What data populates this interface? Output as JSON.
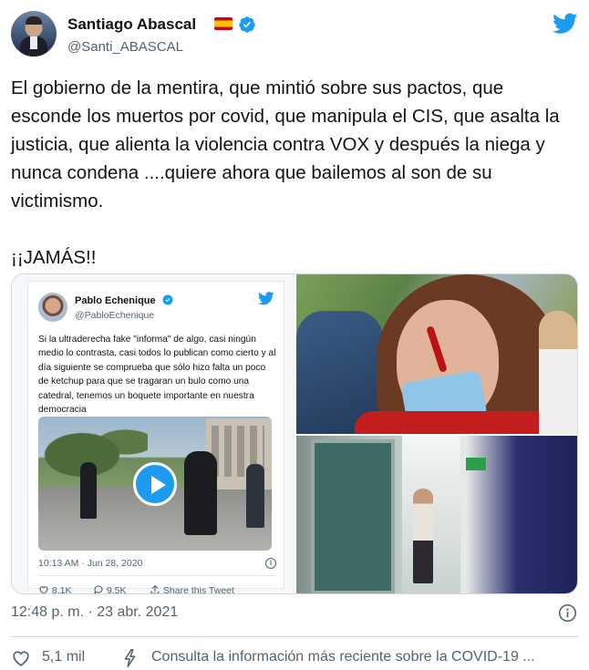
{
  "header": {
    "name": "Santiago Abascal",
    "handle": "@Santi_ABASCAL"
  },
  "tweet": {
    "text": "El gobierno de la mentira, que mintió sobre sus pactos, que esconde los muertos por covid, que manipula el CIS, que asalta la justicia, que alienta la violencia contra VOX y después la niega y nunca condena ....quiere ahora que bailemos al son de su victimismo.\n\n¡¡JAMÁS!!"
  },
  "embedded": {
    "name": "Pablo Echenique",
    "handle": "@PabloEchenique",
    "text": "Si la ultraderecha fake \"informa\" de algo, casi ningún medio lo contrasta, casi todos lo publican como cierto y al día siguiente se comprueba que sólo hizo falta un poco de ketchup para que se tragaran un bulo como una catedral, tenemos un boquete importante en nuestra democracia",
    "time": "10:13 AM · Jun 28, 2020",
    "info": "i",
    "likes": "8.1K",
    "retweets": "9.5K",
    "share": "Share this Tweet"
  },
  "meta": {
    "timestamp": "12:48 p. m. · 23 abr. 2021"
  },
  "footer": {
    "likes": "5,1 mil",
    "covid_notice": "Consulta la información más reciente sobre la COVID-19 ..."
  },
  "colors": {
    "accent": "#1d9bf0",
    "secondary_text": "#536471",
    "border": "#cfd9de"
  },
  "icons": [
    "verified-icon",
    "twitter-bird-icon",
    "spain-flag-icon",
    "play-icon",
    "info-icon",
    "heart-icon",
    "reply-icon",
    "retweet-icon",
    "share-icon",
    "bolt-icon"
  ]
}
